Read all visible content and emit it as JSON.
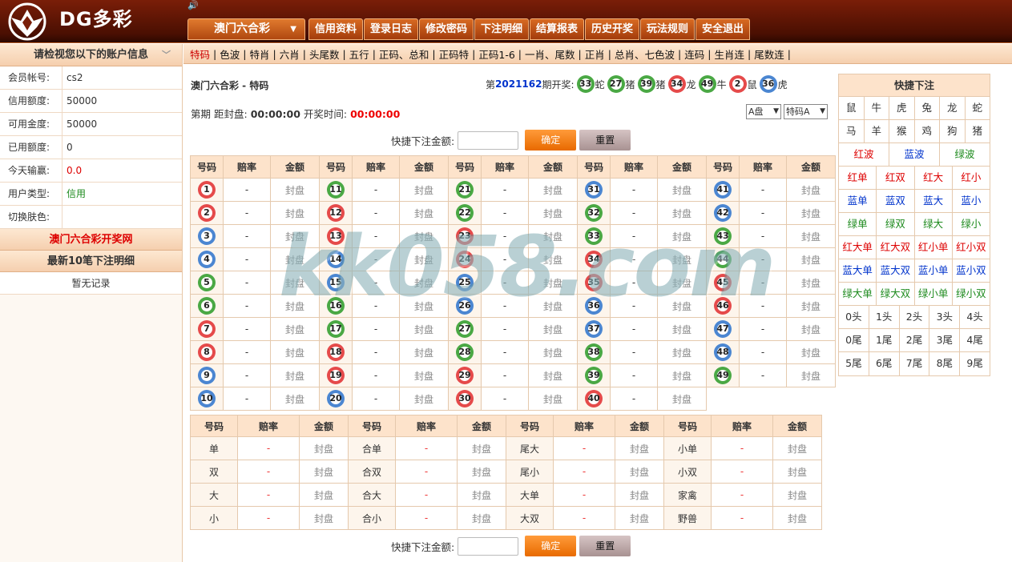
{
  "brand": {
    "name": "DG多彩"
  },
  "lottery_selector": {
    "label": "澳门六合彩"
  },
  "main_nav": [
    "信用资料",
    "登录日志",
    "修改密码",
    "下注明细",
    "结算报表",
    "历史开奖",
    "玩法规则",
    "安全退出"
  ],
  "sub_nav": [
    "特码",
    "色波",
    "特肖",
    "六肖",
    "头尾数",
    "五行",
    "正码、总和",
    "正码特",
    "正码1-6",
    "一肖、尾数",
    "正肖",
    "总肖、七色波",
    "连码",
    "生肖连",
    "尾数连"
  ],
  "account": {
    "header": "请检视您以下的账户信息",
    "rows": [
      {
        "k": "会员帐号:",
        "v": "cs2"
      },
      {
        "k": "信用额度:",
        "v": "50000"
      },
      {
        "k": "可用金度:",
        "v": "50000"
      },
      {
        "k": "已用额度:",
        "v": "0"
      },
      {
        "k": "今天输赢:",
        "v": "0.0"
      },
      {
        "k": "用户类型:",
        "v": "信用"
      },
      {
        "k": "切换肤色:",
        "v": ""
      }
    ],
    "skin_colors": [
      "#1a66e0",
      "#5a9a1c",
      "#f0986a"
    ],
    "link_draw": "澳门六合彩开奖网",
    "recent_header": "最新10笔下注明细",
    "no_record": "暂无记录"
  },
  "page_title": "澳门六合彩 - 特码",
  "draw": {
    "prefix": "第",
    "issue": "2021162",
    "suffix": "期开奖:",
    "balls": [
      {
        "n": "33",
        "z": "蛇",
        "c": "green"
      },
      {
        "n": "27",
        "z": "猪",
        "c": "green"
      },
      {
        "n": "39",
        "z": "猪",
        "c": "green"
      },
      {
        "n": "34",
        "z": "龙",
        "c": "red"
      },
      {
        "n": "49",
        "z": "牛",
        "c": "green"
      },
      {
        "n": "2",
        "z": "鼠",
        "c": "red"
      },
      {
        "n": "36",
        "z": "虎",
        "c": "blue"
      }
    ]
  },
  "timer": {
    "period": "第期",
    "close_label": "距封盘:",
    "close_time": "00:00:00",
    "draw_label": "开奖时间:",
    "draw_time": "00:00:00"
  },
  "selects": {
    "pan": "A盘",
    "type": "特码A"
  },
  "quick_bet": {
    "label": "快捷下注金额:",
    "confirm": "确定",
    "reset": "重置"
  },
  "num_table": {
    "headers": [
      "号码",
      "赔率",
      "金额"
    ],
    "odds": "-",
    "amount": "封盘",
    "red": [
      1,
      2,
      7,
      8,
      12,
      13,
      18,
      19,
      23,
      24,
      29,
      30,
      34,
      35,
      40,
      45,
      46
    ],
    "blue": [
      3,
      4,
      9,
      10,
      14,
      15,
      20,
      25,
      26,
      31,
      36,
      37,
      41,
      42,
      47,
      48
    ],
    "green": [
      5,
      6,
      11,
      16,
      17,
      21,
      22,
      27,
      28,
      32,
      33,
      38,
      39,
      43,
      44,
      49
    ]
  },
  "prop_table": {
    "headers": [
      "号码",
      "赔率",
      "金额"
    ],
    "rows": [
      [
        "单",
        "合单",
        "尾大",
        "小单"
      ],
      [
        "双",
        "合双",
        "尾小",
        "小双"
      ],
      [
        "大",
        "合大",
        "大单",
        "家禽"
      ],
      [
        "小",
        "合小",
        "大双",
        "野兽"
      ]
    ]
  },
  "quick_panel": {
    "title": "快捷下注",
    "rows": [
      [
        {
          "t": "鼠"
        },
        {
          "t": "牛"
        },
        {
          "t": "虎"
        },
        {
          "t": "兔"
        },
        {
          "t": "龙"
        },
        {
          "t": "蛇"
        }
      ],
      [
        {
          "t": "马"
        },
        {
          "t": "羊"
        },
        {
          "t": "猴"
        },
        {
          "t": "鸡"
        },
        {
          "t": "狗"
        },
        {
          "t": "猪"
        }
      ],
      [
        {
          "t": "红波",
          "c": "red"
        },
        {
          "t": "蓝波",
          "c": "blue"
        },
        {
          "t": "绿波",
          "c": "green"
        }
      ],
      [
        {
          "t": "红单",
          "c": "red"
        },
        {
          "t": "红双",
          "c": "red"
        },
        {
          "t": "红大",
          "c": "red"
        },
        {
          "t": "红小",
          "c": "red"
        }
      ],
      [
        {
          "t": "蓝单",
          "c": "blue"
        },
        {
          "t": "蓝双",
          "c": "blue"
        },
        {
          "t": "蓝大",
          "c": "blue"
        },
        {
          "t": "蓝小",
          "c": "blue"
        }
      ],
      [
        {
          "t": "绿单",
          "c": "green"
        },
        {
          "t": "绿双",
          "c": "green"
        },
        {
          "t": "绿大",
          "c": "green"
        },
        {
          "t": "绿小",
          "c": "green"
        }
      ],
      [
        {
          "t": "红大单",
          "c": "red"
        },
        {
          "t": "红大双",
          "c": "red"
        },
        {
          "t": "红小单",
          "c": "red"
        },
        {
          "t": "红小双",
          "c": "red"
        }
      ],
      [
        {
          "t": "蓝大单",
          "c": "blue"
        },
        {
          "t": "蓝大双",
          "c": "blue"
        },
        {
          "t": "蓝小单",
          "c": "blue"
        },
        {
          "t": "蓝小双",
          "c": "blue"
        }
      ],
      [
        {
          "t": "绿大单",
          "c": "green"
        },
        {
          "t": "绿大双",
          "c": "green"
        },
        {
          "t": "绿小单",
          "c": "green"
        },
        {
          "t": "绿小双",
          "c": "green"
        }
      ],
      [
        {
          "t": "0头"
        },
        {
          "t": "1头"
        },
        {
          "t": "2头"
        },
        {
          "t": "3头"
        },
        {
          "t": "4头"
        }
      ],
      [
        {
          "t": "0尾"
        },
        {
          "t": "1尾"
        },
        {
          "t": "2尾"
        },
        {
          "t": "3尾"
        },
        {
          "t": "4尾"
        }
      ],
      [
        {
          "t": "5尾"
        },
        {
          "t": "6尾"
        },
        {
          "t": "7尾"
        },
        {
          "t": "8尾"
        },
        {
          "t": "9尾"
        }
      ]
    ]
  },
  "watermark": "kk058.com"
}
